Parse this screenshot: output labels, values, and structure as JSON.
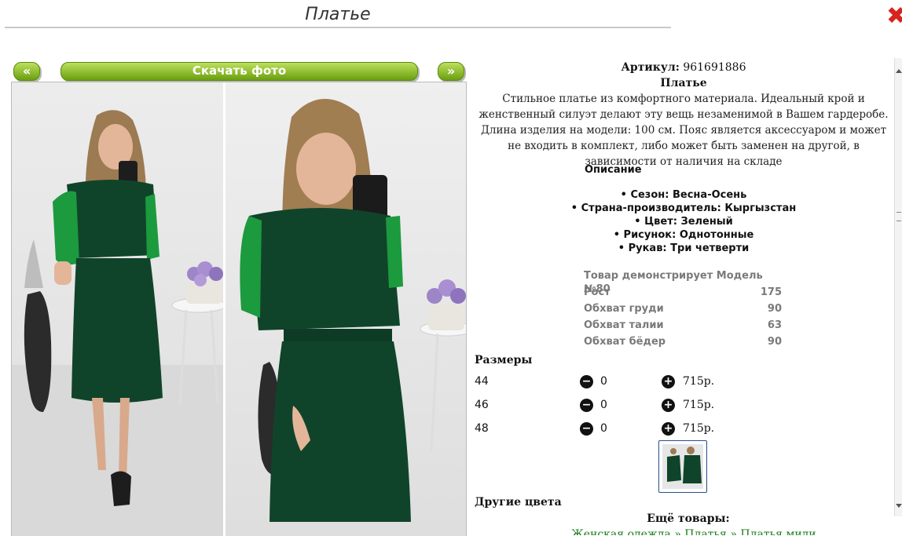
{
  "page": {
    "title": "Платье"
  },
  "nav": {
    "prev": "«",
    "download": "Скачать фото",
    "next": "»"
  },
  "product": {
    "article_label": "Артикул:",
    "article_value": "961691886",
    "name": "Платье",
    "description": "Стильное платье из комфортного материала. Идеальный крой и женственный силуэт делают эту вещь незаменимой в Вашем гардеробе. Длина изделия на модели: 100 см. Пояс является аксессуаром и может не входить в комплект, либо может быть заменен на другой, в зависимости от наличия на складе",
    "section_title": "Описание",
    "properties": [
      "Сезон: Весна-Осень",
      "Страна-производитель: Кыргызстан",
      "Цвет: Зеленый",
      "Рисунок: Однотонные",
      "Рукав: Три четверти"
    ]
  },
  "model": {
    "title": "Товар демонстрирует Модель №80",
    "rows": [
      {
        "label": "Рост",
        "value": "175"
      },
      {
        "label": "Обхват груди",
        "value": "90"
      },
      {
        "label": "Обхват талии",
        "value": "63"
      },
      {
        "label": "Обхват бёдер",
        "value": "90"
      }
    ]
  },
  "sizes": {
    "title": "Размеры",
    "rows": [
      {
        "size": "44",
        "qty": "0",
        "price": "715р."
      },
      {
        "size": "46",
        "qty": "0",
        "price": "715р."
      },
      {
        "size": "48",
        "qty": "0",
        "price": "715р."
      }
    ]
  },
  "other_colors_title": "Другие цвета",
  "more_title": "Ещё товары:",
  "breadcrumbs": [
    "Женская одежда",
    "Платья",
    "Платья миди"
  ],
  "colors": {
    "dress": "#10442a",
    "lace": "#1c9a3e",
    "accent": "#6a9e0f"
  }
}
